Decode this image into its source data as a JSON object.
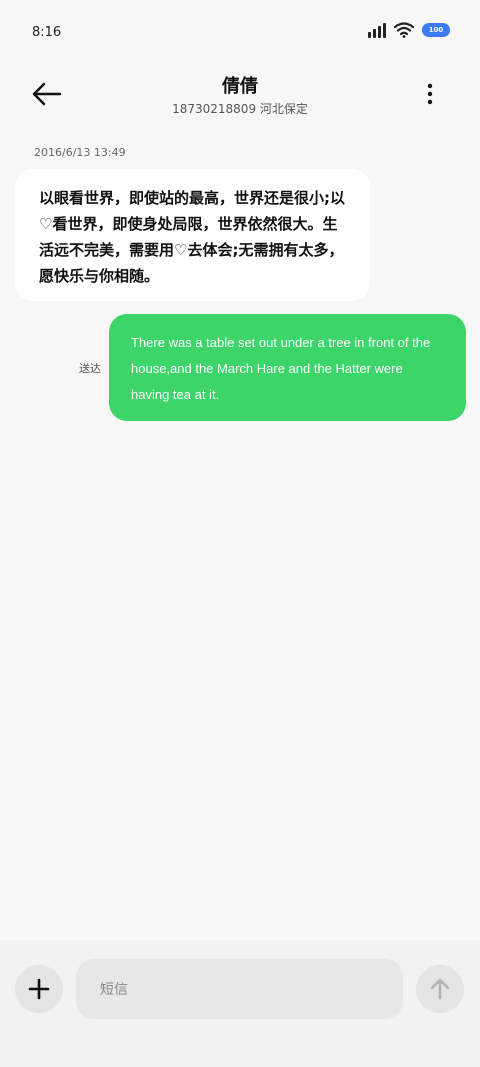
{
  "status": {
    "time": "8:16",
    "battery": "100"
  },
  "header": {
    "title": "倩倩",
    "subtitle": "18730218809 河北保定"
  },
  "thread": {
    "timestamp": "2016/6/13 13:49",
    "incoming_message": "以眼看世界，即使站的最高，世界还是很小;以♡看世界，即使身处局限，世界依然很大。生活远不完美，需要用♡去体会;无需拥有太多，愿快乐与你相随。",
    "outgoing_message": "There was a table set out under a tree in front of the house,and the March Hare and the Hatter were having tea at it.",
    "outgoing_status": "送达"
  },
  "composer": {
    "placeholder": "短信"
  },
  "icons": {
    "back": "arrow-left-icon",
    "more": "more-vertical-icon",
    "add": "plus-icon",
    "send": "arrow-up-icon",
    "signal": "signal-icon",
    "wifi": "wifi-icon",
    "battery": "battery-icon"
  },
  "colors": {
    "outgoing_bubble": "#3dd46a",
    "battery": "#3d7bf2"
  }
}
